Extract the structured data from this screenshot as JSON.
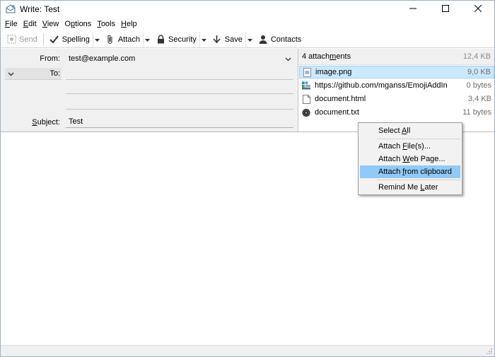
{
  "window": {
    "title": "Write: Test",
    "app_icon": "write-app-icon",
    "controls": [
      "minimize-icon",
      "maximize-icon",
      "close-icon"
    ]
  },
  "menubar": {
    "items": [
      {
        "label": "File",
        "accel": "F",
        "rest": "ile"
      },
      {
        "label": "Edit",
        "accel": "E",
        "rest": "dit"
      },
      {
        "label": "View",
        "accel": "V",
        "rest": "iew"
      },
      {
        "label": "Options",
        "accel": "p",
        "pre": "O",
        "rest": "tions"
      },
      {
        "label": "Tools",
        "accel": "T",
        "rest": "ools"
      },
      {
        "label": "Help",
        "accel": "H",
        "rest": "elp"
      }
    ]
  },
  "toolbar": {
    "send": "Send",
    "spelling": "Spelling",
    "attach": "Attach",
    "security": "Security",
    "save": "Save",
    "contacts": "Contacts"
  },
  "header": {
    "from_label": "From:",
    "from_value": "test@example.com",
    "to_label": "To:",
    "to_value": "",
    "subject_label": "Subject:",
    "subject_value": "Test"
  },
  "attachments": {
    "count_label": "4 attachments",
    "count_pre": "4 attach",
    "count_accel": "m",
    "count_post": "ents",
    "total_size": "12,4 KB",
    "items": [
      {
        "name": "image.png",
        "size": "9,0 KB",
        "icon": "image-file-icon"
      },
      {
        "name": "https://github.com/mganss/EmojiAddIn",
        "size": "0 bytes",
        "icon": "web-link-icon"
      },
      {
        "name": "document.html",
        "size": "3,4 KB",
        "icon": "html-file-icon"
      },
      {
        "name": "document.txt",
        "size": "11 bytes",
        "icon": "text-file-icon"
      }
    ]
  },
  "context_menu": {
    "select_all": {
      "label": "Select All",
      "pre": "Select ",
      "accel": "A",
      "post": "ll"
    },
    "attach_files": {
      "label": "Attach File(s)...",
      "pre": "Attach ",
      "accel": "F",
      "post": "ile(s)..."
    },
    "attach_web": {
      "label": "Attach Web Page...",
      "pre": "Attach ",
      "accel": "W",
      "post": "eb Page..."
    },
    "attach_clipboard": {
      "label": "Attach from clipboard",
      "pre": "Attach ",
      "accel": "f",
      "post": "rom clipboard"
    },
    "remind_later": {
      "label": "Remind Me Later",
      "pre": "Remind Me ",
      "accel": "L",
      "post": "ater"
    }
  },
  "colors": {
    "selection_bg": "#cce8ff",
    "menu_highlight": "#91c9f7",
    "header_bg": "#f0f0f0"
  }
}
